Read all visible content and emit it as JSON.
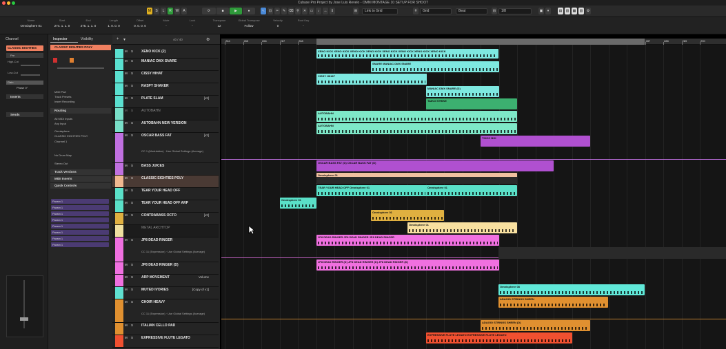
{
  "window": {
    "title": "Cubase Pro Project by Jose Luis Revelo - OMNI MONTAGE 10 SETUP FOR SHOOT"
  },
  "toolbar": {
    "transport_letters": [
      "M",
      "S",
      "L",
      "R",
      "W",
      "A"
    ],
    "snap_mode": "Link to Grid",
    "grid": "Grid",
    "grid_type": "Beat",
    "quantize": "1/8"
  },
  "infoline": {
    "columns": [
      {
        "label": "Name",
        "value": "Omniaphere 01"
      },
      {
        "label": "Start",
        "value": "274. 1. 1. 0"
      },
      {
        "label": "End",
        "value": "275. 1. 1. 0"
      },
      {
        "label": "Length",
        "value": "1. 0. 0. 0"
      },
      {
        "label": "Offset",
        "value": "0. 0. 0. 0"
      },
      {
        "label": "Mute",
        "value": "-"
      },
      {
        "label": "Lock",
        "value": "-"
      },
      {
        "label": "Transpose",
        "value": "12"
      },
      {
        "label": "Global Transpose",
        "value": "Follow"
      },
      {
        "label": "Velocity",
        "value": "0"
      },
      {
        "label": "Root Key",
        "value": "-"
      }
    ]
  },
  "leftzone": {
    "tabs": [
      "Channel",
      "Inspector",
      "Visibility"
    ],
    "channel_name": "CLASSIC EIGHTIES",
    "channel_rows": [
      "Pre",
      "High-Cut",
      "Low-Cut",
      "Gain",
      "Phase 0°",
      "Inserts",
      "Sends"
    ],
    "inspector_track": "CLASSIC EIGHTIES POLY",
    "inspector_rows": [
      "MIDI Part",
      "Track Presets",
      "Insert Recording",
      "All MIDI Inputs",
      "Any Input",
      "Omnisphere",
      "CLASSIC EIGHTIES POLY",
      "Channel 1",
      "No Drum Map",
      "Stereo Out"
    ],
    "sections": [
      "Routing",
      "Track Versions",
      "MIDI Inserts",
      "Quick Controls"
    ],
    "params": [
      "Param 1",
      "Param 1",
      "Param 1",
      "Param 1",
      "Param 1",
      "Param 1",
      "Param 1",
      "Param 1"
    ]
  },
  "tracklist": {
    "count": "40 / 40",
    "tracks": [
      {
        "name": "XENO KICK (2)",
        "color": "#5ae0d0",
        "tag": "",
        "sub": ""
      },
      {
        "name": "MANIAC DMX SNARE",
        "color": "#5ae0d0",
        "tag": "",
        "sub": ""
      },
      {
        "name": "CISSY HIHAT",
        "color": "#5ae0d0",
        "tag": "",
        "sub": ""
      },
      {
        "name": "RASPY SHAKER",
        "color": "#5ae0d0",
        "tag": "",
        "sub": ""
      },
      {
        "name": "PLATE SLAM",
        "color": "#5ae0d0",
        "tag": "[v2]",
        "sub": ""
      },
      {
        "name": "AUTOBAHN",
        "color": "#78dfc8",
        "tag": "",
        "sub": ""
      },
      {
        "name": "AUTOBAHN NEW VERSION",
        "color": "#78dfc8",
        "tag": "",
        "sub": ""
      },
      {
        "name": "OSCAR BASS FAT",
        "color": "#c070e0",
        "tag": "[v2]",
        "sub": "CC 1 (Modulation) · Use Global Settings (Average)"
      },
      {
        "name": "BASS JUICES",
        "color": "#c070e0",
        "tag": "",
        "sub": ""
      },
      {
        "name": "CLASSIC EIGHTIES POLY",
        "color": "#f0b890",
        "tag": "",
        "sub": ""
      },
      {
        "name": "TEAR YOUR HEAD OFF",
        "color": "#5ae0c8",
        "tag": "",
        "sub": ""
      },
      {
        "name": "TEAR YOUR HEAD OFF ARP",
        "color": "#5ae0c8",
        "tag": "",
        "sub": ""
      },
      {
        "name": "CONTRABASS OCTO",
        "color": "#e0b040",
        "tag": "[v2]",
        "sub": ""
      },
      {
        "name": "METAL ARCHTOP",
        "color": "#f0e0a0",
        "tag": "",
        "sub": ""
      },
      {
        "name": "JP8 DEAD RINGER",
        "color": "#f070e0",
        "tag": "",
        "sub": "CC 11 (Expression) · Use Global Settings (Average)"
      },
      {
        "name": "JP8 DEAD RINGER (D)",
        "color": "#f070e0",
        "tag": "",
        "sub": ""
      },
      {
        "name": "ARP MOVEMENT",
        "color": "#f070e0",
        "tag": "Volume",
        "sub": ""
      },
      {
        "name": "MUTED IVORIES",
        "color": "#60e0d0",
        "tag": "[Copy of v1]",
        "sub": ""
      },
      {
        "name": "CHOIR HEAVY",
        "color": "#e09030",
        "tag": "",
        "sub": "CC 11 (Expression) · Use Global Settings (Average)"
      },
      {
        "name": "ITALIAN CELLO PAD",
        "color": "#e09030",
        "tag": "",
        "sub": ""
      },
      {
        "name": "EXPRESSIVE FLUTE LEGATO",
        "color": "#f05030",
        "tag": "",
        "sub": ""
      }
    ]
  },
  "ruler": {
    "bars": [
      "264",
      "265",
      "266",
      "267",
      "268",
      "269",
      "270",
      "271",
      "272",
      "273",
      "274",
      "275",
      "276",
      "277",
      "278",
      "279",
      "280",
      "281",
      "282",
      "283",
      "284",
      "285",
      "286",
      "287",
      "288",
      "289",
      "290"
    ]
  },
  "events": [
    {
      "label": "XENO KICK  XENO KICK  XENO KICK  XENO KICK  XENO KICK  XENO KICK  XENO KICK  XENO KICK",
      "color": "#7ee8e0"
    },
    {
      "label": "SNARE  MANIAC DMX SNARE",
      "color": "#7ee8e0"
    },
    {
      "label": "CISSY HIHAT",
      "color": "#7ee8e0"
    },
    {
      "label": "MANIAC DMX SNARE (D)",
      "color": "#7ee8e0"
    },
    {
      "label": "TAIKO STRIKE",
      "color": "#3cb070"
    },
    {
      "label": "AUTOBAHN",
      "color": "#7ee8c8"
    },
    {
      "label": "AUTOBAHN",
      "color": "#7ee8c8"
    },
    {
      "label": "THICC BOI",
      "color": "#b050d0"
    },
    {
      "label": "OSCAR BASS FAT (D)   OSCAR BASS FAT (D)",
      "color": "#b050d0"
    },
    {
      "label": "Omnisphere 01",
      "color": "#f0c0a0"
    },
    {
      "label": "TEAR YOUR HEAD OFF   Omnisphere 01",
      "color": "#5ae0c8"
    },
    {
      "label": "Omnisphere 01",
      "color": "#5ae0c8"
    },
    {
      "label": "Omnisphere 01",
      "color": "#e0b040"
    },
    {
      "label": "Omnisphere 01",
      "color": "#f8e0a0"
    },
    {
      "label": "JP8 DEAD RINGER   JP8 DEAD RINGER   JP8 DEAD RINGER",
      "color": "#f070e0"
    },
    {
      "label": "JP8 DEAD RINGER (D)   JP8 DEAD RINGER (D)   JP8 DEAD RINGER (D)",
      "color": "#f070e0"
    },
    {
      "label": "Omnisphere 08",
      "color": "#60e8d8"
    },
    {
      "label": "ADAGIO STRINGS SHEEN",
      "color": "#e09030"
    },
    {
      "label": "ADAGIO STRINGS SHEEN (D)",
      "color": "#e09030"
    },
    {
      "label": "EXPRESSIVE FLUTE LEGATO   EXPRESSIVE FLUTE LEGATO",
      "color": "#f05030"
    }
  ]
}
